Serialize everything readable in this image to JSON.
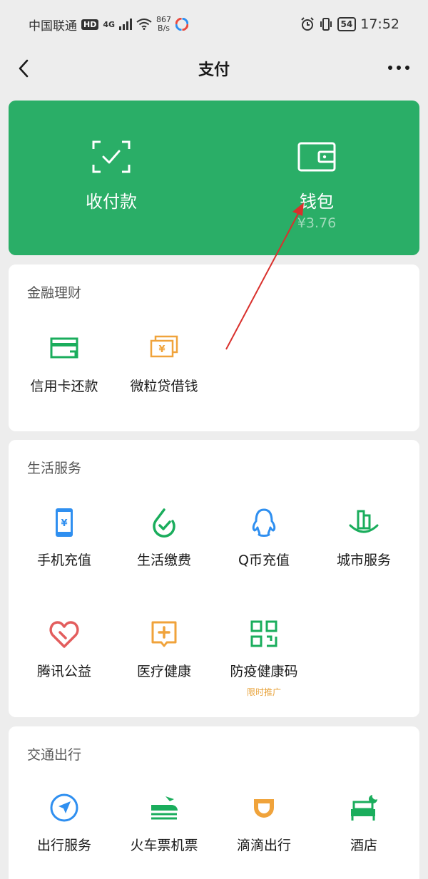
{
  "status_bar": {
    "carrier": "中国联通",
    "hd": "HD",
    "net_type": "4G",
    "speed_value": "867",
    "speed_unit": "B/s",
    "battery": "54",
    "time": "17:52"
  },
  "nav": {
    "title": "支付",
    "back_icon": "back-chevron-icon",
    "more_icon": "more-dots-icon"
  },
  "hero": {
    "pay": {
      "label": "收付款",
      "icon": "scan-check-icon"
    },
    "wallet": {
      "label": "钱包",
      "balance": "¥3.76",
      "icon": "wallet-icon"
    }
  },
  "finance": {
    "title": "金融理财",
    "items": [
      {
        "label": "信用卡还款",
        "icon": "credit-card-icon"
      },
      {
        "label": "微粒贷借钱",
        "icon": "loan-bills-icon"
      }
    ]
  },
  "life": {
    "title": "生活服务",
    "items": [
      {
        "label": "手机充值",
        "icon": "phone-recharge-icon"
      },
      {
        "label": "生活缴费",
        "icon": "utility-bill-icon"
      },
      {
        "label": "Q币充值",
        "icon": "qq-penguin-icon"
      },
      {
        "label": "城市服务",
        "icon": "city-buildings-icon"
      },
      {
        "label": "腾讯公益",
        "icon": "charity-heart-icon"
      },
      {
        "label": "医疗健康",
        "icon": "medical-cross-icon"
      },
      {
        "label": "防疫健康码",
        "icon": "qr-code-icon",
        "tag": "限时推广"
      }
    ]
  },
  "transport": {
    "title": "交通出行",
    "items": [
      {
        "label": "出行服务",
        "icon": "navigation-icon"
      },
      {
        "label": "火车票机票",
        "icon": "train-plane-icon"
      },
      {
        "label": "滴滴出行",
        "icon": "didi-icon"
      },
      {
        "label": "酒店",
        "icon": "hotel-bed-icon"
      }
    ]
  },
  "colors": {
    "hero_bg": "#2aae67",
    "green_icon": "#1aad5c",
    "blue_icon": "#2f8ff0",
    "orange_icon": "#f0a33b",
    "red_icon": "#e35d5d",
    "arrow": "#d9302c"
  }
}
